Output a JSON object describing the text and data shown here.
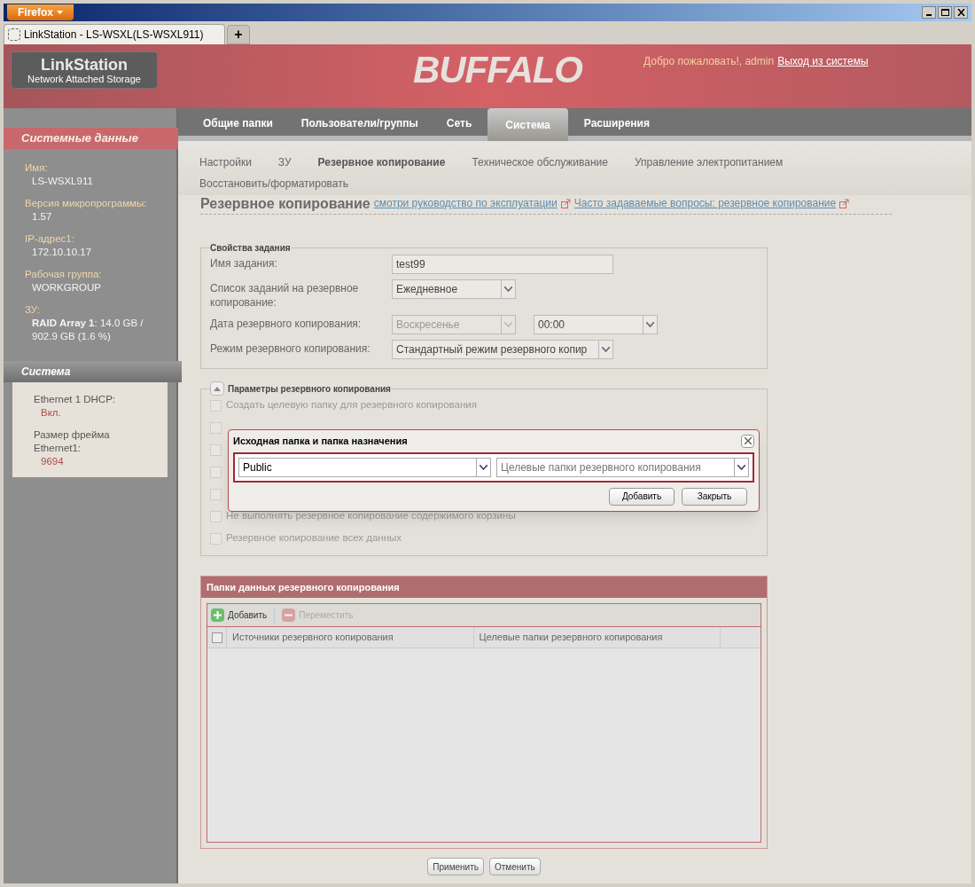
{
  "browser": {
    "menu_button": "Firefox",
    "tab_title": "LinkStation - LS-WSXL(LS-WSXL911)",
    "new_tab": "+"
  },
  "header": {
    "logo_title": "LinkStation",
    "logo_subtitle": "Network Attached Storage",
    "brand": "BUFFALO",
    "welcome": "Добро пожаловать!, admin",
    "logout": "Выход из системы"
  },
  "nav": [
    {
      "label": "Общие папки",
      "selected": false
    },
    {
      "label": "Пользователи/группы",
      "selected": false
    },
    {
      "label": "Сеть",
      "selected": false
    },
    {
      "label": "Система",
      "selected": true
    },
    {
      "label": "Расширения",
      "selected": false
    }
  ],
  "subnav": [
    {
      "label": "Настройки",
      "selected": false
    },
    {
      "label": "ЗУ",
      "selected": false
    },
    {
      "label": "Резервное копирование",
      "selected": true
    },
    {
      "label": "Техническое обслуживание",
      "selected": false
    },
    {
      "label": "Управление электропитанием",
      "selected": false
    },
    {
      "label": "Восстановить/форматировать",
      "selected": false
    }
  ],
  "sidebar": [
    {
      "title": "Системные данные",
      "kind": "dark",
      "items": [
        {
          "label": "Имя:",
          "value": "LS-WSXL911"
        },
        {
          "label": "Версия микропрограммы:",
          "value": "1.57"
        },
        {
          "label": "IP-адрес1:",
          "value": "172.10.10.17"
        },
        {
          "label": "Рабочая группа:",
          "value": "WORKGROUP"
        },
        {
          "label": "ЗУ:",
          "value": "**RAID Array 1**: 14.0 GB / 902.9 GB (1.6 %)"
        }
      ]
    },
    {
      "title": "Система",
      "kind": "light",
      "items": [
        {
          "label": "Ethernet 1 DHCP:",
          "value": "Вкл."
        },
        {
          "label": "Размер фрейма Ethernet1:",
          "value": "9694"
        }
      ]
    }
  ],
  "page": {
    "title": "Резервное копирование",
    "links": [
      "смотри руководство по эксплуатации",
      "Часто задаваемые вопросы: резервное копирование"
    ]
  },
  "job_properties": {
    "legend": "Свойства задания",
    "fields": [
      {
        "label": "Имя задания:",
        "controls": [
          {
            "kind": "text",
            "value": "test99",
            "disabled": false
          }
        ]
      },
      {
        "label": "Список заданий на резервное копирование:",
        "controls": [
          {
            "kind": "select",
            "value": "Ежедневное",
            "disabled": false
          }
        ]
      },
      {
        "label": "Дата резервного копирования:",
        "controls": [
          {
            "kind": "select",
            "value": "Воскресенье",
            "disabled": true
          },
          {
            "kind": "select",
            "value": "00:00",
            "disabled": false
          }
        ]
      },
      {
        "label": "Режим резервного копирования:",
        "controls": [
          {
            "kind": "select",
            "value": "Стандартный режим резервного копир",
            "disabled": false
          }
        ]
      }
    ]
  },
  "options": {
    "legend": "Параметры резервного копирования",
    "expanded": true,
    "checkboxes": [
      {
        "label": "Создать целевую папку для резервного копирования",
        "checked": false,
        "disabled": true
      },
      {
        "checked": false,
        "disabled": true
      },
      {
        "checked": false,
        "disabled": true
      },
      {
        "checked": false,
        "disabled": true
      },
      {
        "checked": false,
        "disabled": true
      },
      {
        "label": "Не выполнять резервное копирование содержимого корзины",
        "checked": false,
        "disabled": true
      },
      {
        "label": "Резервное копирование всех данных",
        "checked": false,
        "disabled": true
      }
    ]
  },
  "dialog": {
    "title": "Исходная папка и папка назначения",
    "source": {
      "value": "Public"
    },
    "target": {
      "placeholder": "Целевые папки резервного копирования"
    },
    "buttons": [
      "Добавить",
      "Закрыть"
    ]
  },
  "folders_panel": {
    "title": "Папки данных резервного копирования",
    "toolbar": [
      {
        "kind": "add",
        "label": "Добавить",
        "disabled": false
      },
      {
        "kind": "remove",
        "label": "Переместить",
        "disabled": true
      }
    ],
    "select_all_checked": false,
    "columns": [
      "Источники резервного копирования",
      "Целевые папки резервного копирования"
    ]
  },
  "buttons": [
    "Применить",
    "Отменить"
  ]
}
